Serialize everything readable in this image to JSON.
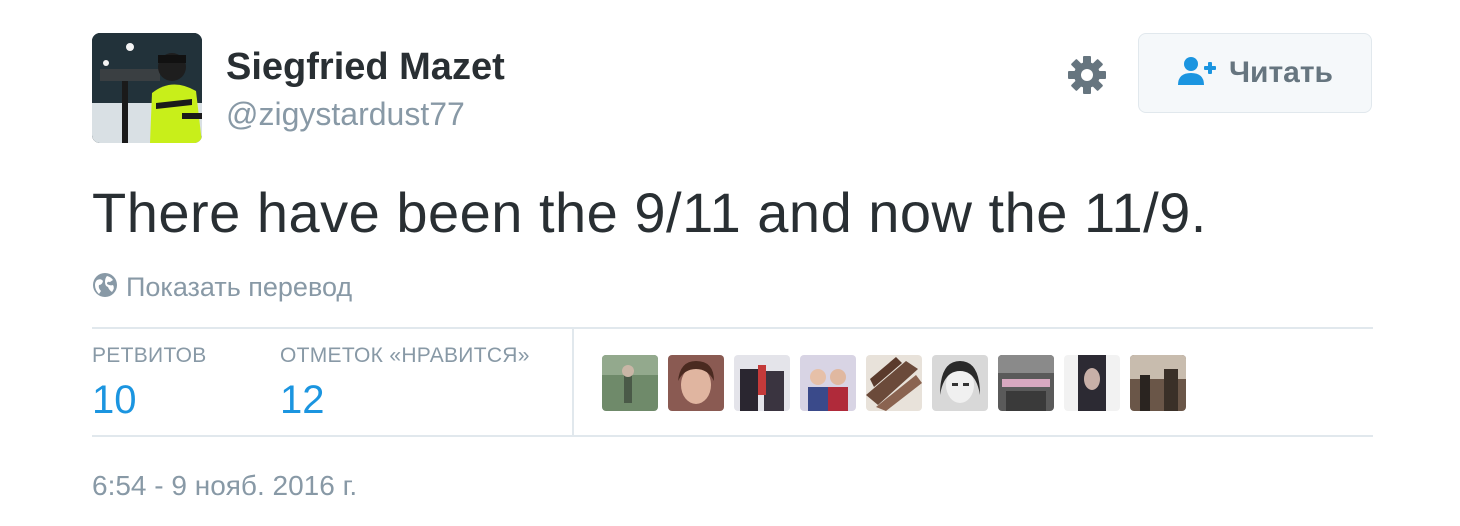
{
  "author": {
    "name": "Siegfried Mazet",
    "handle": "@zigystardust77",
    "avatar_icon": "biathlete-avatar"
  },
  "header": {
    "settings_icon": "gear-icon",
    "follow_button": {
      "label": "Читать",
      "icon": "add-user-icon"
    }
  },
  "tweet": {
    "text": "There have been the 9/11 and now the 11/9.",
    "translate_label": "Показать перевод",
    "translate_icon": "globe-icon",
    "timestamp": "6:54 - 9 нояб. 2016 г."
  },
  "stats": {
    "retweets": {
      "label": "РЕТВИТОВ",
      "value": "10"
    },
    "likes": {
      "label": "ОТМЕТОК «НРАВИТСЯ»",
      "value": "12"
    }
  },
  "likers": [
    {
      "name": "liker-avatar-1",
      "color": "#6f8a6a"
    },
    {
      "name": "liker-avatar-2",
      "color": "#8a5a52"
    },
    {
      "name": "liker-avatar-3",
      "color": "#3a3440"
    },
    {
      "name": "liker-avatar-4",
      "color": "#b9b2c8"
    },
    {
      "name": "liker-avatar-5",
      "color": "#6b4a3a"
    },
    {
      "name": "liker-avatar-6",
      "color": "#9a9a9a"
    },
    {
      "name": "liker-avatar-7",
      "color": "#5a5a5a"
    },
    {
      "name": "liker-avatar-8",
      "color": "#2c2a33"
    },
    {
      "name": "liker-avatar-9",
      "color": "#6a5648"
    }
  ],
  "colors": {
    "text_primary": "#292f33",
    "text_secondary": "#8899a6",
    "accent_blue": "#1b95e0",
    "border": "#e1e8ed"
  }
}
